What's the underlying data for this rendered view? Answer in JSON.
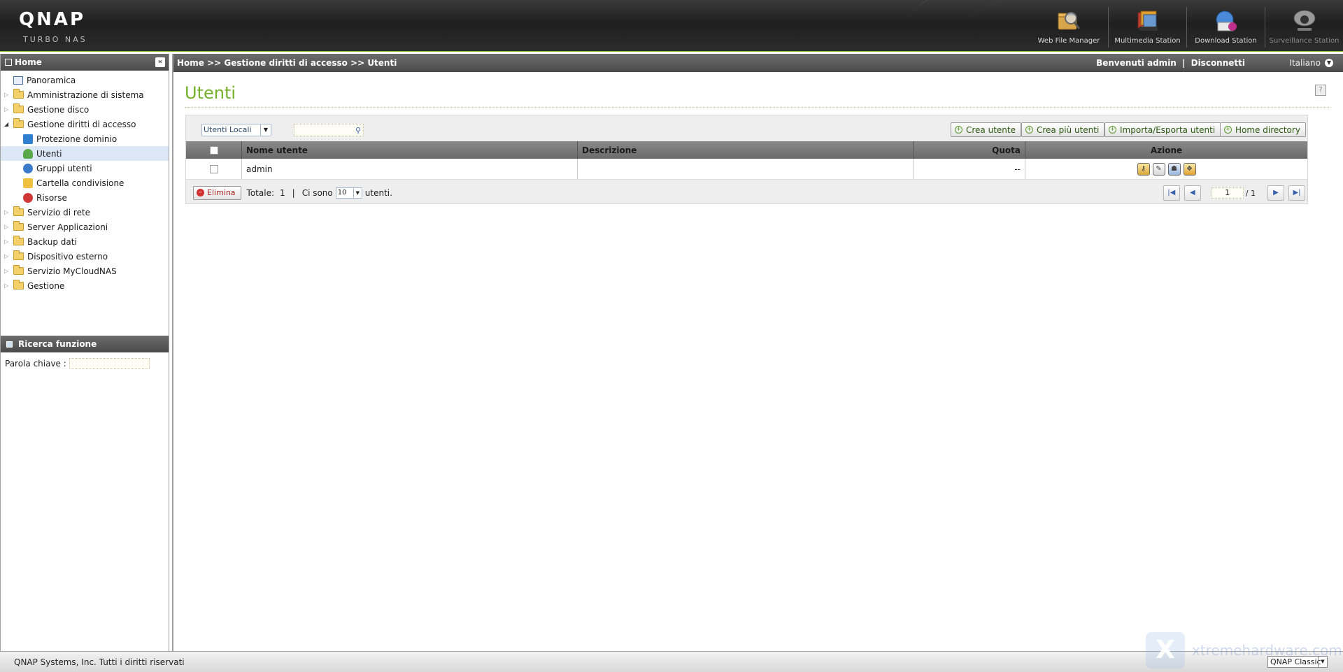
{
  "header": {
    "logo": "QNAP",
    "logo_sub": "TURBO NAS",
    "apps": [
      {
        "label": "Web File Manager",
        "icon": "web-file-manager-icon"
      },
      {
        "label": "Multimedia Station",
        "icon": "multimedia-station-icon"
      },
      {
        "label": "Download Station",
        "icon": "download-station-icon"
      },
      {
        "label": "Surveillance Station",
        "icon": "surveillance-station-icon"
      }
    ]
  },
  "sidebar": {
    "title": "Home",
    "tree": [
      {
        "label": "Panoramica"
      },
      {
        "label": "Amministrazione di sistema"
      },
      {
        "label": "Gestione disco"
      },
      {
        "label": "Gestione diritti di accesso"
      },
      {
        "label": "Protezione dominio"
      },
      {
        "label": "Utenti"
      },
      {
        "label": "Gruppi utenti"
      },
      {
        "label": "Cartella condivisione"
      },
      {
        "label": "Risorse"
      },
      {
        "label": "Servizio di rete"
      },
      {
        "label": "Server Applicazioni"
      },
      {
        "label": "Backup dati"
      },
      {
        "label": "Dispositivo esterno"
      },
      {
        "label": "Servizio MyCloudNAS"
      },
      {
        "label": "Gestione"
      }
    ],
    "search": {
      "title": "Ricerca funzione",
      "keyword_label": "Parola chiave :"
    }
  },
  "topbar": {
    "breadcrumb": "Home >> Gestione diritti di accesso >> Utenti",
    "welcome": "Benvenuti admin",
    "separator": "|",
    "logout": "Disconnetti",
    "language": "Italiano"
  },
  "page": {
    "title": "Utenti",
    "user_type_select": "Utenti Locali",
    "buttons": {
      "create_user": "Crea utente",
      "create_multiple": "Crea più utenti",
      "import_export": "Importa/Esporta utenti",
      "home_directory": "Home directory"
    },
    "columns": {
      "name": "Nome utente",
      "description": "Descrizione",
      "quota": "Quota",
      "action": "Azione"
    },
    "rows": [
      {
        "name": "admin",
        "description": "",
        "quota": "--"
      }
    ],
    "footer": {
      "delete": "Elimina",
      "total_label": "Totale:",
      "total_value": "1",
      "sep": "|",
      "ci_sono": "Ci sono",
      "per_page": "10",
      "utenti": "utenti."
    },
    "pager": {
      "current": "1",
      "total": "/ 1"
    }
  },
  "statusbar": {
    "copyright": "QNAP Systems, Inc. Tutti i diritti riservati",
    "theme": "QNAP Classic"
  },
  "watermark": "xtremehardware.com",
  "colors": {
    "accent_green": "#74b02a",
    "header_dark": "#1f1f1f",
    "bar_gray": "#5a5a5a"
  }
}
